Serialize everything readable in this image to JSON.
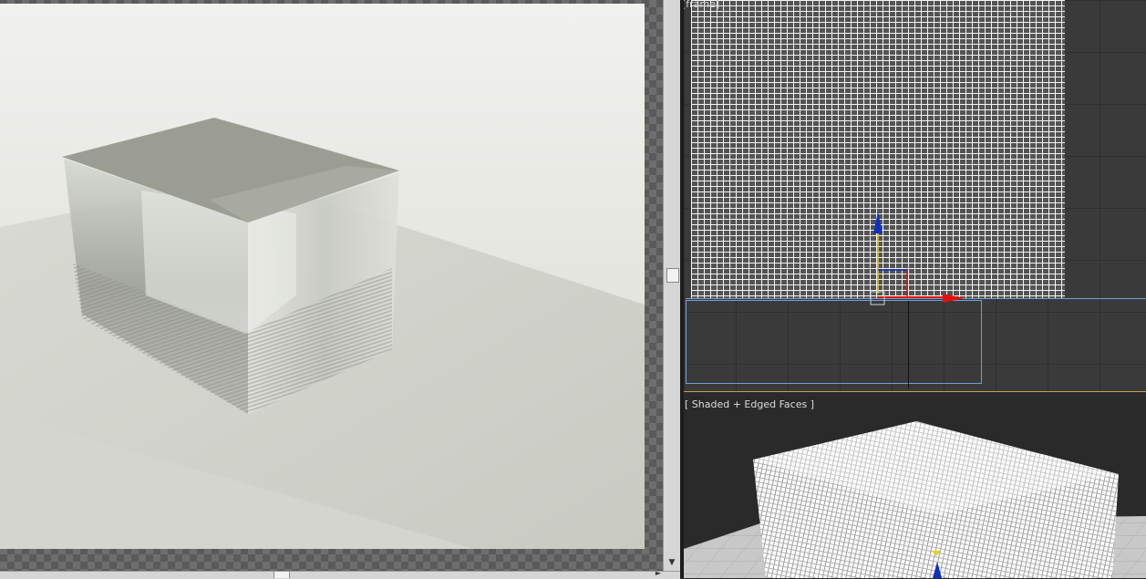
{
  "viewports": {
    "top": {
      "label": "[frame]"
    },
    "bottom": {
      "label": "[ Shaded + Edged Faces ]"
    }
  },
  "render_frame": {
    "scroll_down_glyph": "▼",
    "scroll_right_glyph": "►"
  },
  "colors": {
    "selection": "#6f9fd8",
    "active_viewport": "#c8a050",
    "gizmo_x": "#e01010",
    "gizmo_z": "#1030c0",
    "gizmo_y": "#e0d020"
  }
}
